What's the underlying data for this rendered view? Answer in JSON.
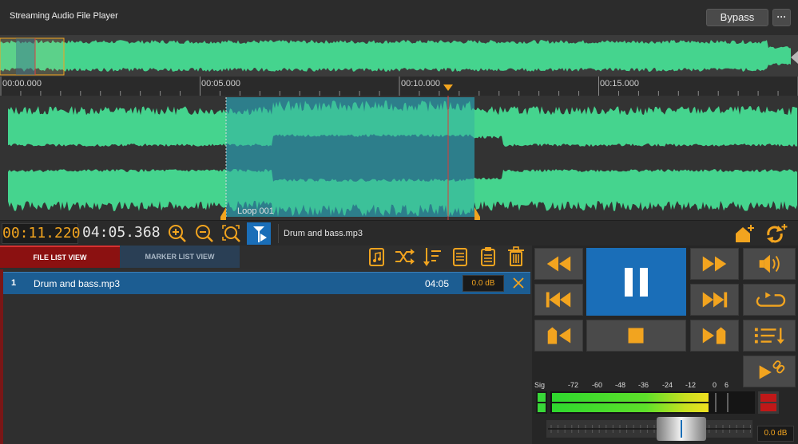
{
  "app": {
    "title": "Streaming Audio File Player"
  },
  "header": {
    "bypass_label": "Bypass",
    "more_label": "···"
  },
  "ruler": {
    "ticks": [
      "00:00.000",
      "00:05.000",
      "00:10.000",
      "00:15.000"
    ]
  },
  "waveform": {
    "loop_label": "Loop 001",
    "color": "#45d48e",
    "selection_color": "#2a9fb0"
  },
  "toolbar": {
    "position": "00:11.220",
    "length": "04:05.368",
    "current_file": "Drum and bass.mp3"
  },
  "tabs": {
    "file_list": "FILE LIST VIEW",
    "marker_list": "MARKER LIST VIEW"
  },
  "file_list": [
    {
      "index": "1",
      "name": "Drum and bass.mp3",
      "duration": "04:05",
      "gain": "0.0 dB"
    }
  ],
  "meter": {
    "sig_label": "Sig",
    "scale": [
      "-72",
      "-60",
      "-48",
      "-36",
      "-24",
      "-12",
      "0",
      "6"
    ]
  },
  "gain": {
    "value": "0.0 dB"
  },
  "colors": {
    "accent": "#f2a41f",
    "play_blue": "#1a6eb8",
    "wave_green": "#45d48e",
    "tab_red": "#8b1111"
  }
}
